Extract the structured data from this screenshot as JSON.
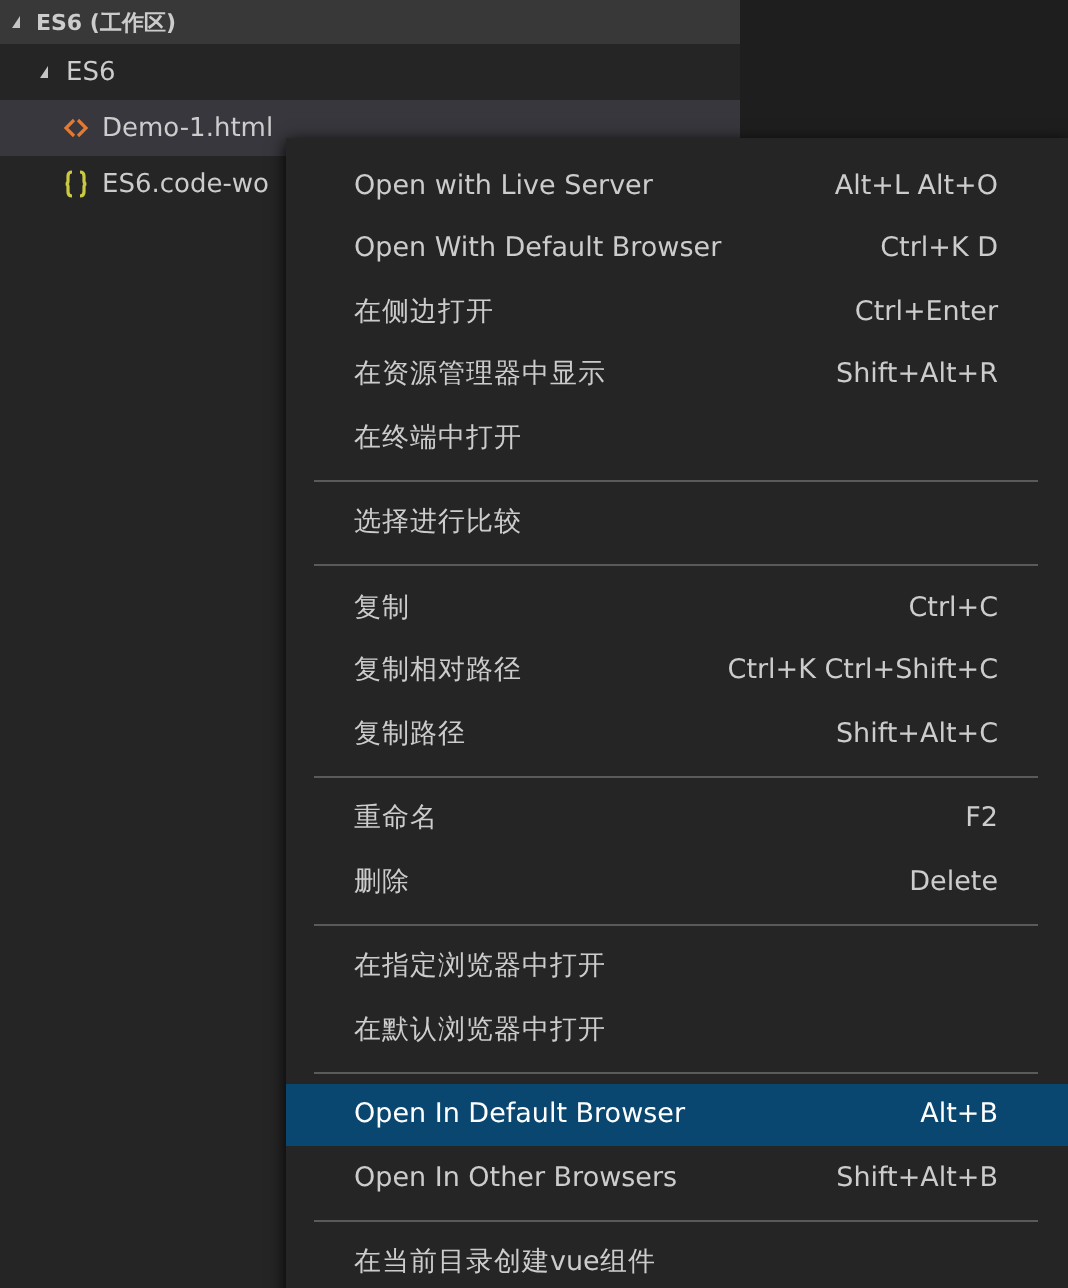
{
  "explorer": {
    "title": "ES6 (工作区)",
    "expanded": true,
    "tree": [
      {
        "label": "ES6",
        "expanded": true,
        "selected": false,
        "children": [
          {
            "label": "Demo-1.html",
            "kind": "html",
            "selected": true
          },
          {
            "label": "ES6.code-wo",
            "kind": "json",
            "selected": false
          }
        ]
      }
    ]
  },
  "context_menu": {
    "groups": [
      [
        {
          "label": "Open with Live Server",
          "shortcut": "Alt+L Alt+O",
          "selected": false
        },
        {
          "label": "Open With Default Browser",
          "shortcut": "Ctrl+K D",
          "selected": false
        },
        {
          "label": "在侧边打开",
          "shortcut": "Ctrl+Enter",
          "selected": false
        },
        {
          "label": "在资源管理器中显示",
          "shortcut": "Shift+Alt+R",
          "selected": false
        },
        {
          "label": "在终端中打开",
          "selected": false
        }
      ],
      [
        {
          "label": "选择进行比较",
          "selected": false
        }
      ],
      [
        {
          "label": "复制",
          "shortcut": "Ctrl+C",
          "selected": false
        },
        {
          "label": "复制相对路径",
          "shortcut": "Ctrl+K Ctrl+Shift+C",
          "selected": false
        },
        {
          "label": "复制路径",
          "shortcut": "Shift+Alt+C",
          "selected": false
        }
      ],
      [
        {
          "label": "重命名",
          "shortcut": "F2",
          "selected": false
        },
        {
          "label": "删除",
          "shortcut": "Delete",
          "selected": false
        }
      ],
      [
        {
          "label": "在指定浏览器中打开",
          "selected": false
        },
        {
          "label": "在默认浏览器中打开",
          "selected": false
        }
      ],
      [
        {
          "label": "Open In Default Browser",
          "shortcut": "Alt+B",
          "selected": true
        },
        {
          "label": "Open In Other Browsers",
          "shortcut": "Shift+Alt+B",
          "selected": false
        }
      ],
      [
        {
          "label": "在当前目录创建vue组件",
          "selected": false
        }
      ]
    ]
  }
}
